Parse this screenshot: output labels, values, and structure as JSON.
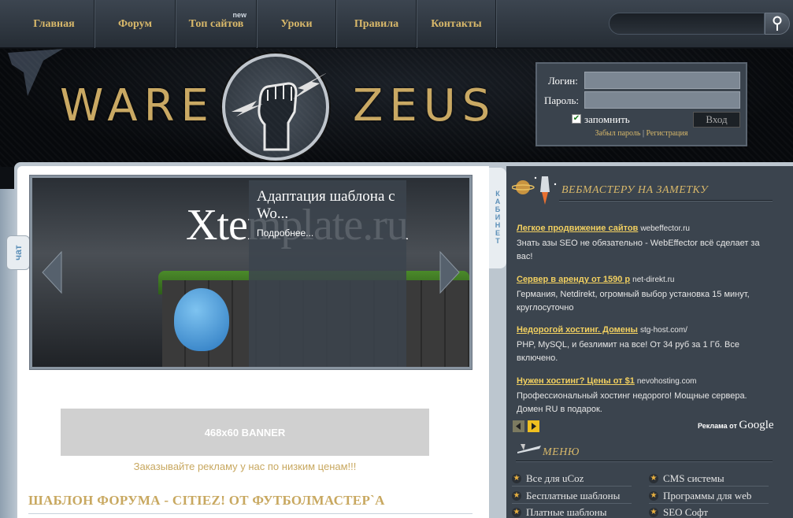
{
  "nav": {
    "items": [
      "Главная",
      "Форум",
      "Топ сайтов",
      "Уроки",
      "Правила",
      "Контакты"
    ],
    "new_badge": "new",
    "search_placeholder": ""
  },
  "logo": {
    "left": "WARE",
    "right": "ZEUS"
  },
  "login": {
    "login_label": "Логин:",
    "password_label": "Пароль:",
    "remember_label": "запомнить",
    "remember_checked": true,
    "submit": "Вход",
    "forgot": "Забыл пароль",
    "separator": "|",
    "register": "Регистрация"
  },
  "tabs": {
    "chat": "чат",
    "cabinet": "КАБИНЕТ"
  },
  "slider": {
    "image_text": "Xtemplate.ru",
    "caption_title": "Адаптация шаблона с Wo...",
    "caption_more": "Подробнее..."
  },
  "banner": {
    "label": "468x60 BANNER",
    "caption": "Заказывайте рекламу у нас по низким ценам!!!"
  },
  "post": {
    "title": "ШАБЛОН ФОРУМА - CITIEZ! ОТ ФУТБОЛМАСТЕР`А"
  },
  "sidebar": {
    "webmaster_heading": "ВЕБМАСТЕРУ НА ЗАМЕТКУ",
    "ads": [
      {
        "title": "Легкое продвижение сайтов",
        "domain": "webeffector.ru",
        "desc": "Знать азы SEO не обязательно - WebEffector всё сделает за вас!"
      },
      {
        "title": "Сервер в аренду от 1590 р",
        "domain": "net-direkt.ru",
        "desc": "Германия, Netdirekt, огромный выбор установка 15 минут, круглосуточно"
      },
      {
        "title": "Недорогой хостинг. Домены",
        "domain": "stg-host.com/",
        "desc": "PHP, MySQL, и безлимит на все! От 34 руб за 1 Гб. Все включено."
      },
      {
        "title": "Нужен хостинг? Цены от $1",
        "domain": "nevohosting.com",
        "desc": "Профессиональный хостинг недорого! Мощные сервера. Домен RU в подарок."
      }
    ],
    "ads_by": "Реклама от",
    "google": "Google",
    "menu_heading": "МЕНЮ",
    "menu_left": [
      "Все для uCoz",
      "Бесплатные шаблоны",
      "Платные шаблоны"
    ],
    "menu_right": [
      "CMS системы",
      "Программы для web",
      "SEO Софт"
    ]
  },
  "colors": {
    "accent_gold": "#c8a860",
    "link_yellow": "#f2d060",
    "panel": "#3b444e"
  }
}
